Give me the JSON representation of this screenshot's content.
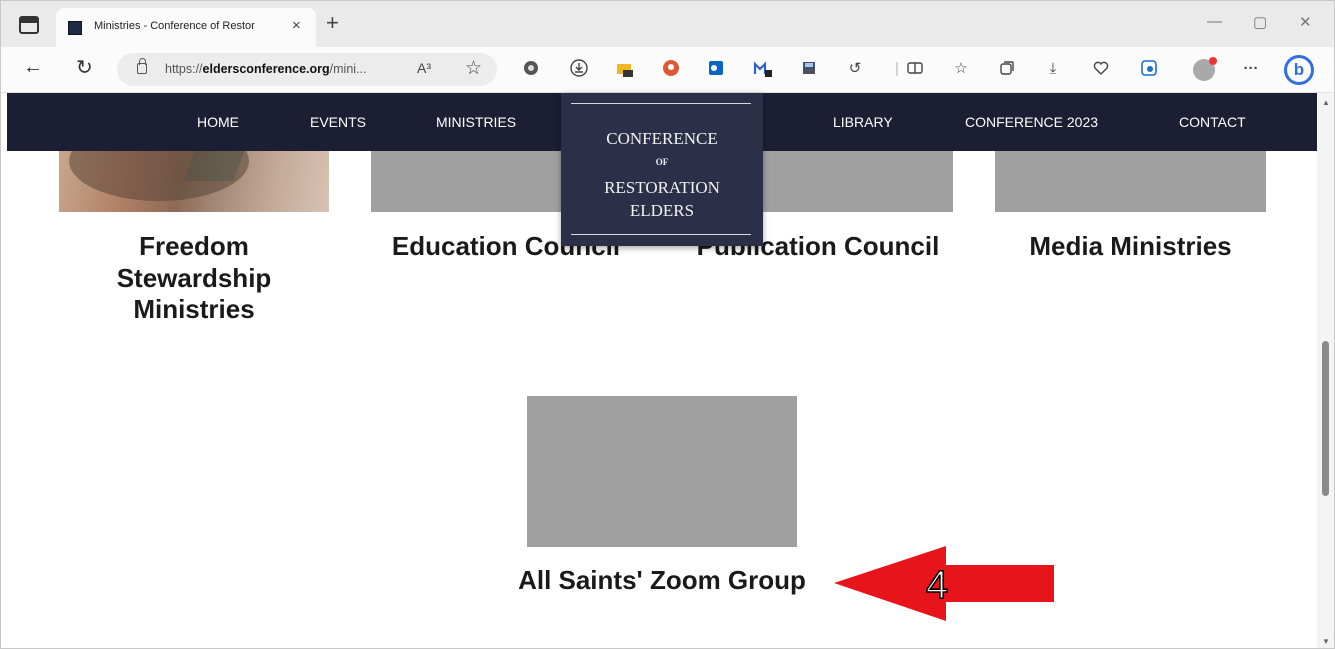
{
  "browser": {
    "tab_title": "Ministries - Conference of Restor",
    "tab_close_glyph": "×",
    "new_tab_glyph": "+",
    "url_prefix": "https://",
    "url_domain": "eldersconference.org",
    "url_path": "/mini...",
    "read_aloud_glyph": "A³",
    "window_controls": {
      "minimize": "—",
      "maximize": "▢",
      "close": "✕"
    },
    "toolbar_icons": [
      "tracking-icon",
      "download-extension-icon",
      "folder-extension-icon",
      "duckduckgo-icon",
      "outlook-icon",
      "mail-extension-icon",
      "save-extension-icon",
      "refresh-extension-icon",
      "split-screen-icon",
      "favorites-icon",
      "collections-icon",
      "downloads-icon",
      "performance-icon",
      "copilot-icon",
      "profile-icon",
      "more-icon",
      "bing-icon"
    ],
    "more_glyph": "···",
    "bing_glyph": "b"
  },
  "site_nav": {
    "items": [
      "HOME",
      "EVENTS",
      "MINISTRIES",
      "LIBRARY",
      "CONFERENCE 2023",
      "CONTACT"
    ]
  },
  "logo": {
    "line1": "CONFERENCE",
    "line2": "OF",
    "line3": "RESTORATION",
    "line4": "ELDERS"
  },
  "ministries": [
    {
      "name": "Freedom Stewardship Ministries",
      "line1": "Freedom",
      "line2": "Stewardship",
      "line3": "Ministries"
    },
    {
      "name": "Education Council"
    },
    {
      "name": "Publication Council"
    },
    {
      "name": "Media Ministries"
    },
    {
      "name": "All Saints' Zoom Group"
    }
  ],
  "annotation": {
    "label": "4",
    "color": "#e8141c"
  },
  "colors": {
    "nav_bg": "#1c1f33",
    "logo_bg": "#2b2f48",
    "placeholder_gray": "#a0a0a0"
  }
}
